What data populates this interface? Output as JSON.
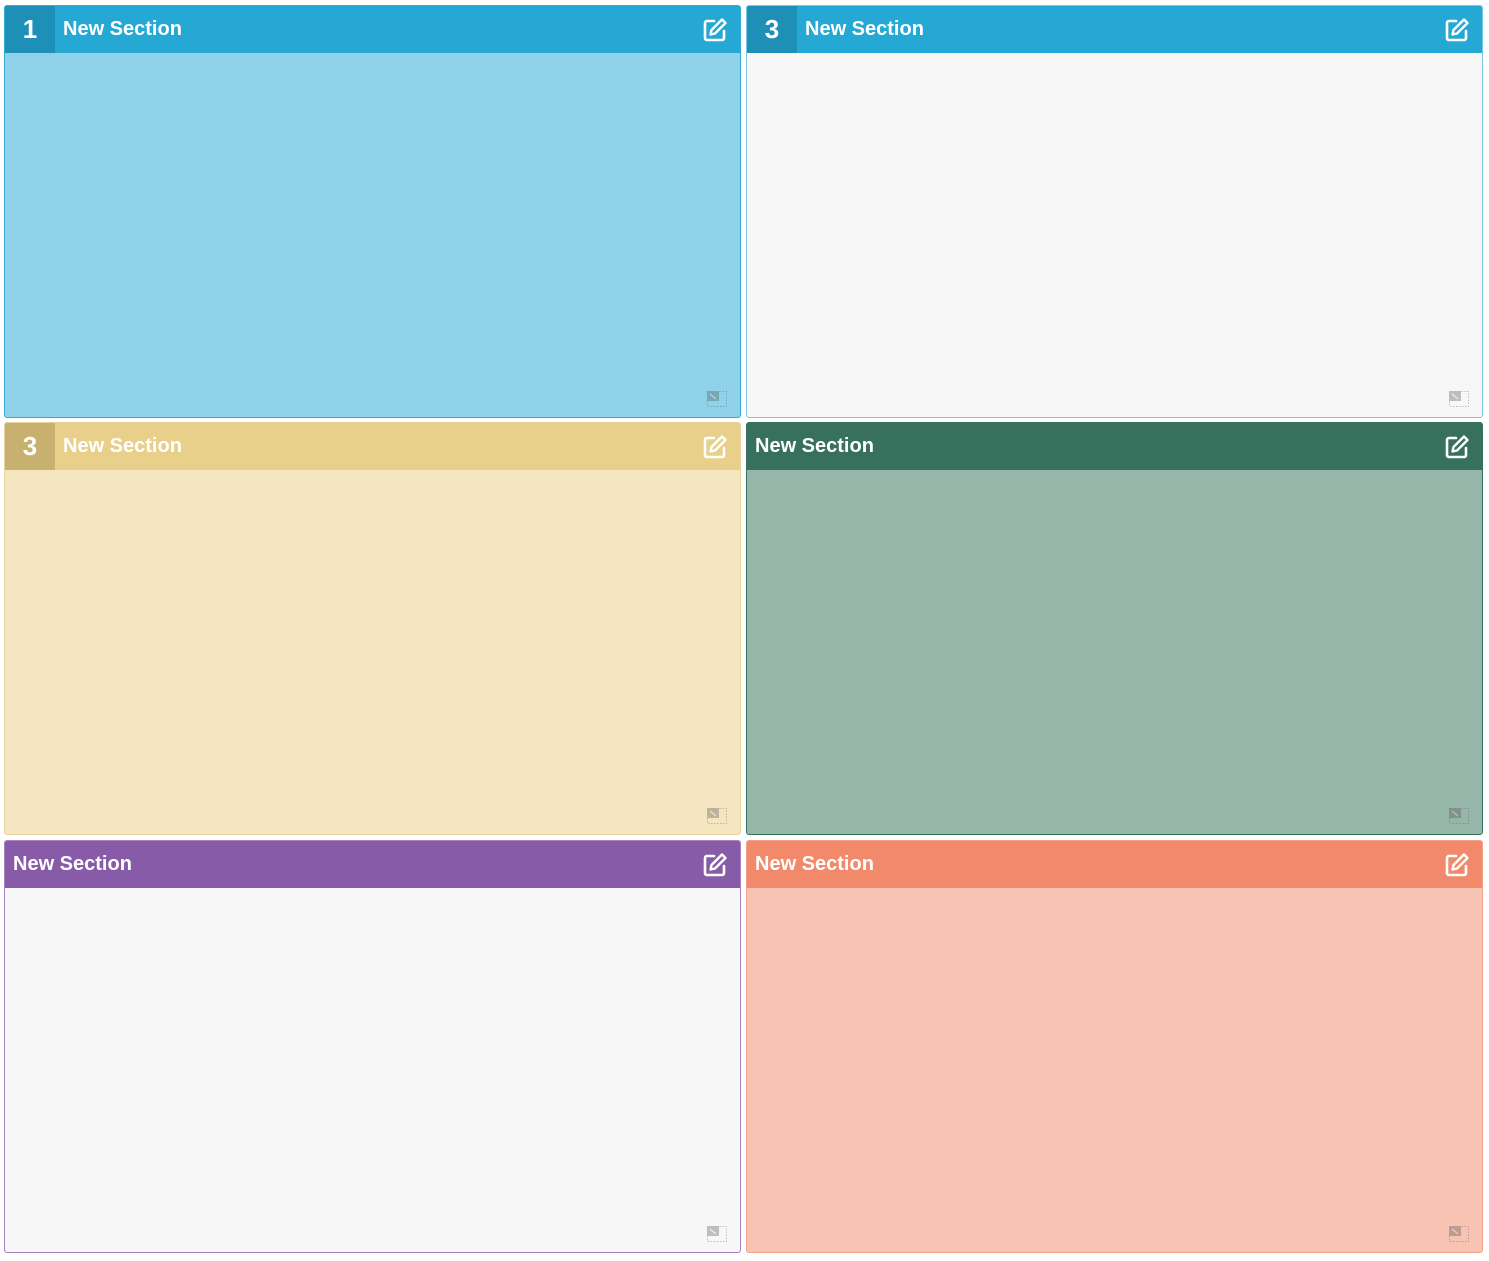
{
  "sections": [
    {
      "number": "1",
      "title": "New Section",
      "header_color": "#25a8d4",
      "number_color": "#1e8fb6",
      "body_color": "#90d2ea",
      "border_color": "#36a9d4"
    },
    {
      "number": "3",
      "title": "New Section",
      "header_color": "#25a8d4",
      "number_color": "#1e8fb6",
      "body_color": "#f7f7f7",
      "border_color": "#7bc8e3"
    },
    {
      "number": "3",
      "title": "New Section",
      "header_color": "#e8d08a",
      "number_color": "#c8b06e",
      "body_color": "#f5e6c1",
      "border_color": "#e6d3a0"
    },
    {
      "number": "",
      "title": "New Section",
      "header_color": "#37705c",
      "number_color": "",
      "body_color": "#97b6aa",
      "border_color": "#37705c"
    },
    {
      "number": "",
      "title": "New Section",
      "header_color": "#885ba9",
      "number_color": "",
      "body_color": "#f7f7f7",
      "border_color": "#a684c2"
    },
    {
      "number": "",
      "title": "New Section",
      "header_color": "#f2896b",
      "number_color": "",
      "body_color": "#f7c3b2",
      "border_color": "#f2a28a"
    }
  ],
  "icons": {
    "edit": "edit-icon",
    "resize": "resize-icon"
  }
}
